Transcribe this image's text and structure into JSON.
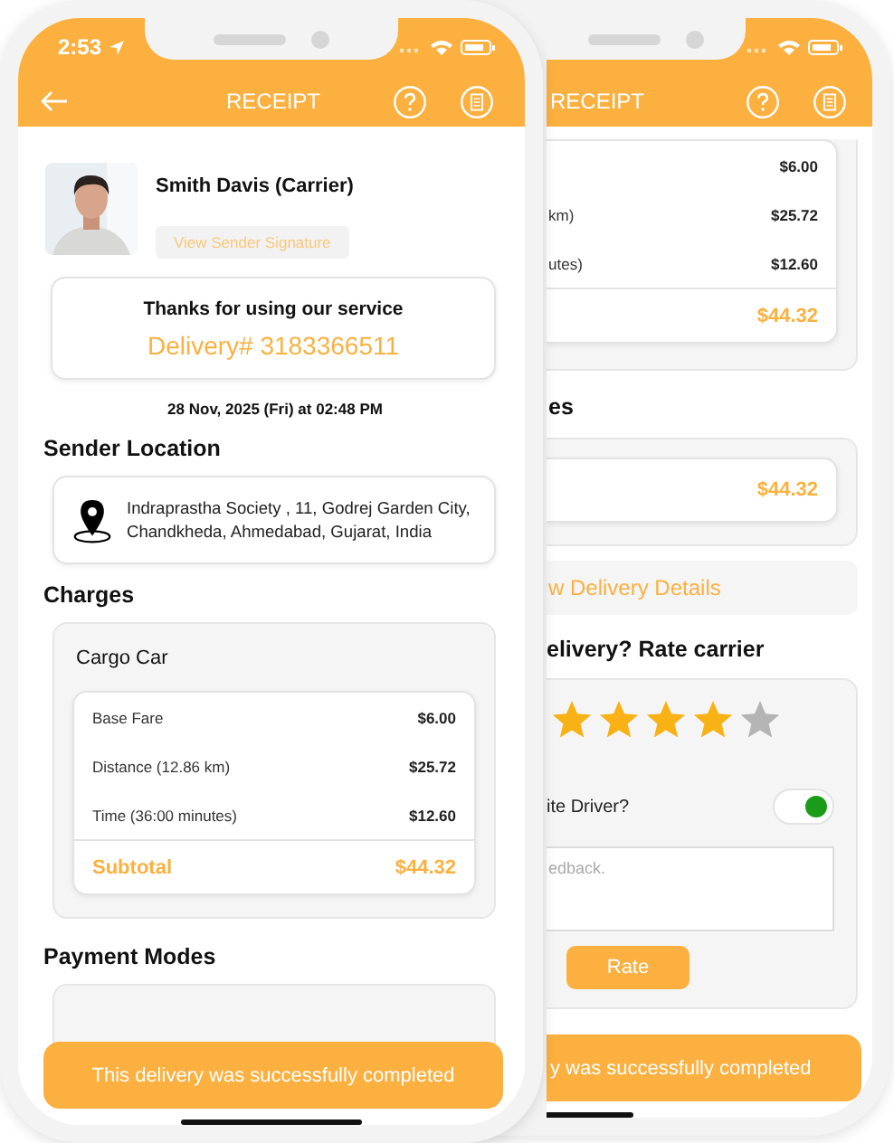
{
  "back_phone": {
    "header": {
      "title": "RECEIPT"
    },
    "charges": {
      "rows": [
        {
          "label": "",
          "amount": "$6.00"
        },
        {
          "label": "km)",
          "amount": "$25.72"
        },
        {
          "label": "utes)",
          "amount": "$12.60"
        }
      ],
      "subtotal": "$44.32"
    },
    "payment_heading": "es",
    "payment_amount": "$44.32",
    "details_button": "w Delivery Details",
    "rating": {
      "heading": "elivery? Rate carrier",
      "stars": 4,
      "favorite": {
        "label": "ite Driver?",
        "on": true
      },
      "feedback": {
        "placeholder": "edback."
      },
      "button": "Rate"
    },
    "banner": "y was successfully completed"
  },
  "front_phone": {
    "status_bar": {
      "time": "2:53"
    },
    "header": {
      "title": "RECEIPT"
    },
    "carrier": {
      "name": "Smith Davis (Carrier)",
      "signature_button": "View Sender Signature"
    },
    "thanks_card": {
      "message": "Thanks for using our service",
      "delivery_number": "Delivery# 3183366511"
    },
    "date": "28 Nov, 2025 (Fri) at 02:48 PM",
    "sender_location": {
      "heading": "Sender Location",
      "address": "Indraprastha Society , 11, Godrej Garden City, Chandkheda, Ahmedabad, Gujarat, India"
    },
    "charges": {
      "heading": "Charges",
      "vehicle": "Cargo Car",
      "rows": [
        {
          "label": "Base Fare",
          "amount": "$6.00"
        },
        {
          "label": "Distance (12.86 km)",
          "amount": "$25.72"
        },
        {
          "label": "Time (36:00 minutes)",
          "amount": "$12.60"
        }
      ],
      "subtotal": {
        "label": "Subtotal",
        "amount": "$44.32"
      }
    },
    "payment_modes": {
      "heading": "Payment Modes"
    },
    "banner": "This delivery was successfully completed"
  }
}
